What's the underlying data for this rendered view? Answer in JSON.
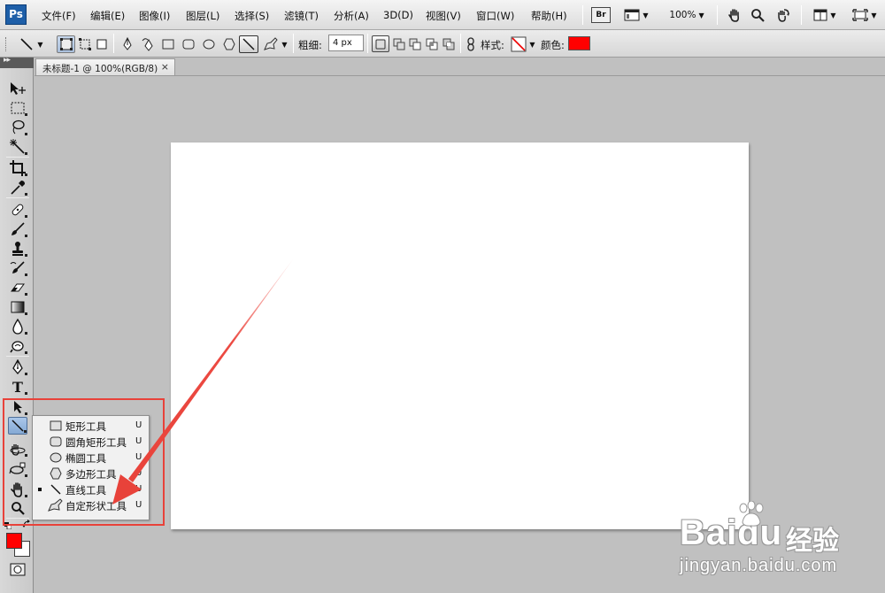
{
  "app": {
    "logo": "Ps"
  },
  "menu": {
    "items": [
      "文件(F)",
      "编辑(E)",
      "图像(I)",
      "图层(L)",
      "选择(S)",
      "滤镜(T)",
      "分析(A)",
      "3D(D)",
      "视图(V)",
      "窗口(W)",
      "帮助(H)"
    ],
    "bridge_label": "Br",
    "zoom": "100%",
    "icons": [
      "bridge-icon",
      "screen-layout-icon",
      "hand-icon",
      "zoom-icon",
      "rotate-view-icon",
      "arrange-documents-icon",
      "screen-mode-icon"
    ]
  },
  "options": {
    "weight_label": "粗细:",
    "weight_value": "4 px",
    "style_label": "样式:",
    "color_label": "颜色:",
    "color": "#ff0000"
  },
  "document": {
    "tab_title": "未标题-1 @ 100%(RGB/8)",
    "close_glyph": "×",
    "canvas_color": "#ffffff"
  },
  "tools": [
    "move-tool-icon",
    "marquee-tool-icon",
    "lasso-tool-icon",
    "magic-wand-tool-icon",
    "crop-tool-icon",
    "eyedropper-tool-icon",
    "healing-brush-tool-icon",
    "brush-tool-icon",
    "clone-stamp-tool-icon",
    "history-brush-tool-icon",
    "eraser-tool-icon",
    "gradient-tool-icon",
    "blur-tool-icon",
    "dodge-tool-icon",
    "pen-tool-icon",
    "type-tool-icon",
    "path-selection-tool-icon",
    "line-tool-icon",
    "3d-rotate-tool-icon",
    "3d-orbit-tool-icon",
    "hand-tool-icon",
    "zoom-tool-icon"
  ],
  "type_tool_glyph": "T",
  "colors": {
    "foreground": "#ff0000",
    "background": "#ffffff",
    "annotation": "#e8423a"
  },
  "flyout": {
    "items": [
      {
        "label": "矩形工具",
        "key": "U",
        "icon": "rectangle-shape-icon",
        "selected": false
      },
      {
        "label": "圆角矩形工具",
        "key": "U",
        "icon": "rounded-rectangle-icon",
        "selected": false
      },
      {
        "label": "椭圆工具",
        "key": "U",
        "icon": "ellipse-icon",
        "selected": false
      },
      {
        "label": "多边形工具",
        "key": "U",
        "icon": "polygon-icon",
        "selected": false
      },
      {
        "label": "直线工具",
        "key": "U",
        "icon": "line-icon",
        "selected": true
      },
      {
        "label": "自定形状工具",
        "key": "U",
        "icon": "custom-shape-icon",
        "selected": false
      }
    ]
  },
  "watermark": {
    "brand": "Baidu",
    "product": "经验",
    "url": "jingyan.baidu.com"
  }
}
